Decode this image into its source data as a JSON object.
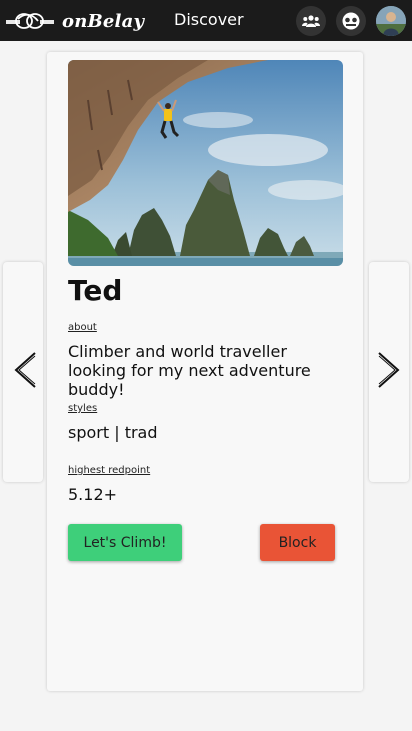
{
  "header": {
    "app_name": "onBelay",
    "nav_title": "Discover"
  },
  "profile": {
    "name": "Ted",
    "about_label": "about",
    "about_text": "Climber and world traveller looking for my next adventure buddy!",
    "styles_label": "styles",
    "styles_value": "sport | trad",
    "redpoint_label": "highest redpoint",
    "redpoint_value": "5.12+"
  },
  "actions": {
    "climb_label": "Let's Climb!",
    "block_label": "Block"
  },
  "colors": {
    "climb_button": "#3ecf7a",
    "block_button": "#e95436",
    "header_bg": "#1b1b1b"
  },
  "icons": {
    "logo": "rope-knot-icon",
    "friends": "people-icon",
    "messages": "chat-icon",
    "prev": "chevron-left-icon",
    "next": "chevron-right-icon"
  }
}
